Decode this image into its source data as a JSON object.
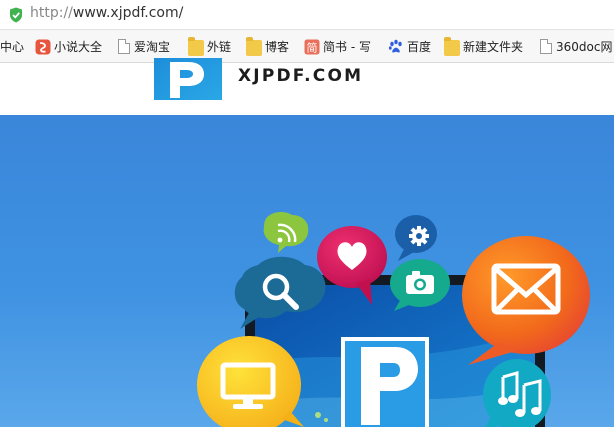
{
  "browser": {
    "url_scheme": "http://",
    "url_host": "www.xjpdf.com/"
  },
  "bookmarks": [
    {
      "label": "中心",
      "icon": "none"
    },
    {
      "label": "小说大全",
      "icon": "novel-app-icon"
    },
    {
      "label": "爱淘宝",
      "icon": "page-icon"
    },
    {
      "label": "外链",
      "icon": "folder-icon"
    },
    {
      "label": "博客",
      "icon": "folder-icon"
    },
    {
      "label": "简书 - 写",
      "icon": "jianshu-icon"
    },
    {
      "label": "百度",
      "icon": "baidu-paw-icon"
    },
    {
      "label": "新建文件夹",
      "icon": "folder-icon"
    },
    {
      "label": "360doc网",
      "icon": "page-icon"
    }
  ],
  "site": {
    "name": "XJPDF.COM",
    "brand_color": "#1e88d6"
  },
  "hero": {
    "background": "#3a86da",
    "bubbles": [
      {
        "icon": "rss-icon",
        "color": "#8cc63e"
      },
      {
        "icon": "gear-icon",
        "color": "#1a5fa8"
      },
      {
        "icon": "heart-icon",
        "color": "#d8145f"
      },
      {
        "icon": "search-icon",
        "color": "#1c6a96"
      },
      {
        "icon": "camera-icon",
        "color": "#15a98e"
      },
      {
        "icon": "mail-icon",
        "color": "#f47921"
      },
      {
        "icon": "monitor-icon",
        "color": "#f7c21c"
      },
      {
        "icon": "music-icon",
        "color": "#12a9c5"
      }
    ]
  }
}
